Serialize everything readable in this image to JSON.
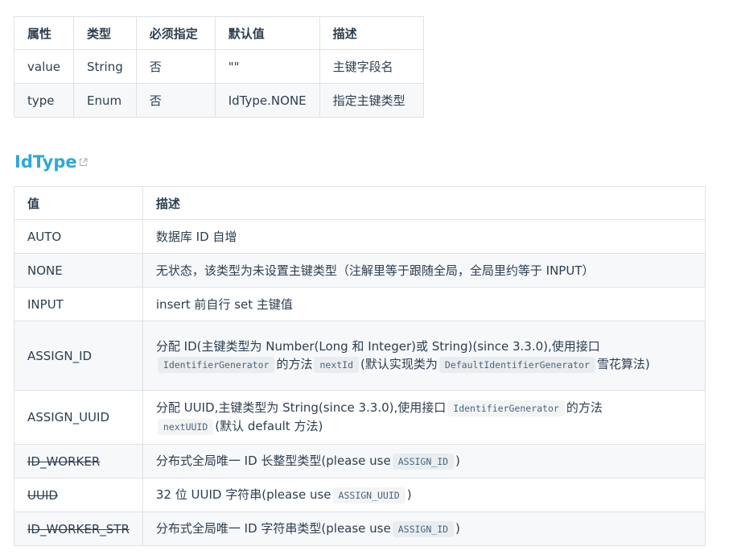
{
  "attr_table": {
    "headers": [
      "属性",
      "类型",
      "必须指定",
      "默认值",
      "描述"
    ],
    "rows": [
      [
        "value",
        "String",
        "否",
        "\"\"",
        "主键字段名"
      ],
      [
        "type",
        "Enum",
        "否",
        "IdType.NONE",
        "指定主键类型"
      ]
    ]
  },
  "idtype_section": {
    "heading": "IdType",
    "icon": "external-link-icon",
    "headers": [
      "值",
      "描述"
    ],
    "rows": {
      "auto": {
        "value": "AUTO",
        "desc": "数据库 ID 自增"
      },
      "none": {
        "value": "NONE",
        "desc": "无状态，该类型为未设置主键类型（注解里等于跟随全局，全局里约等于 INPUT）"
      },
      "input": {
        "value": "INPUT",
        "desc": "insert 前自行 set 主键值"
      },
      "assign_id": {
        "value": "ASSIGN_ID",
        "desc_1": "分配 ID(主键类型为 Number(Long 和 Integer)或 String)(since 3.3.0),使用接口",
        "code_1": "IdentifierGenerator",
        "desc_2": "的方法",
        "code_2": "nextId",
        "desc_3": "(默认实现类为",
        "code_3": "DefaultIdentifierGenerator",
        "desc_4": "雪花算法)"
      },
      "assign_uuid": {
        "value": "ASSIGN_UUID",
        "desc_1": "分配 UUID,主键类型为 String(since 3.3.0),使用接口",
        "code_1": "IdentifierGenerator",
        "desc_2": "的方法",
        "code_2": "nextUUID",
        "desc_3": "(默认 default 方法)"
      },
      "id_worker": {
        "value": "ID_WORKER",
        "desc_1": "分布式全局唯一 ID 长整型类型(please use",
        "code_1": "ASSIGN_ID",
        "desc_2": ")"
      },
      "uuid": {
        "value": "UUID",
        "desc_1": "32 位 UUID 字符串(please use",
        "code_1": "ASSIGN_UUID",
        "desc_2": ")"
      },
      "id_worker_str": {
        "value": "ID_WORKER_STR",
        "desc_1": "分布式全局唯一 ID 字符串类型(please use",
        "code_1": "ASSIGN_ID",
        "desc_2": ")"
      }
    }
  },
  "colors": {
    "heading": "#2ea8d6",
    "border": "#dfe2e5",
    "stripe": "#f6f8fa",
    "text": "#2c3e50",
    "code": "#476582"
  }
}
